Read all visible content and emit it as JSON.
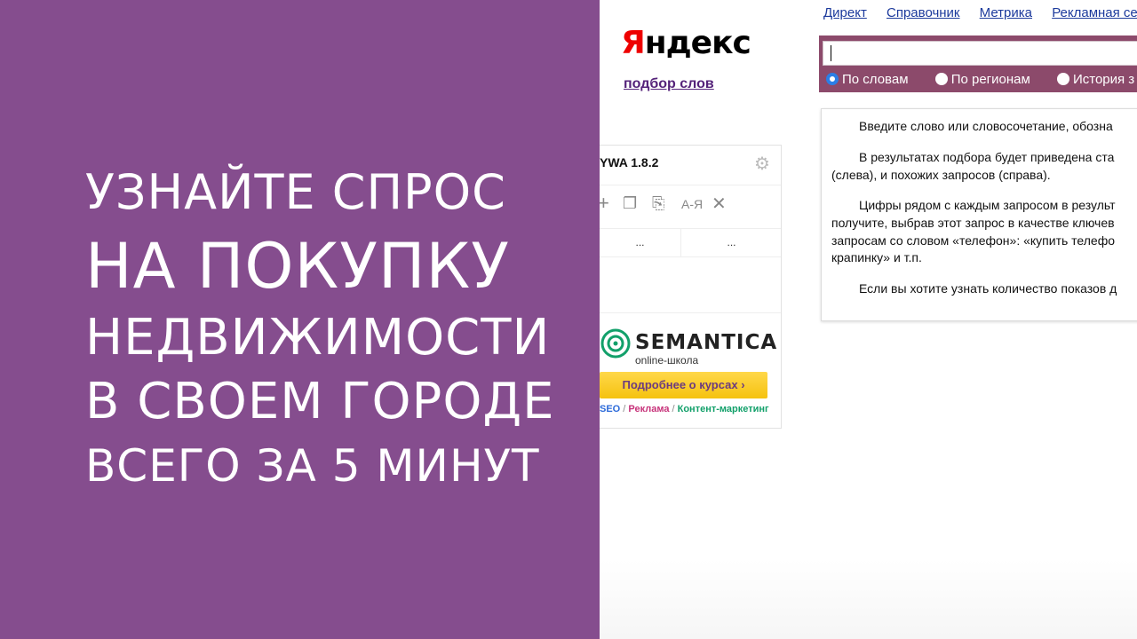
{
  "headline": {
    "line1": "УЗНАЙТЕ СПРОС",
    "line2": "НА ПОКУПКУ",
    "line3": "НЕДВИЖИМОСТИ",
    "line4": "В СВОЕМ ГОРОДЕ",
    "line5": "ВСЕГО ЗА 5 МИНУТ"
  },
  "topnav": [
    "Директ",
    "Справочник",
    "Метрика",
    "Рекламная се"
  ],
  "logo": {
    "first": "Я",
    "rest": "ндекс"
  },
  "subtitle": "подбор слов",
  "search": {
    "value": "",
    "options": [
      {
        "label": "По словам",
        "selected": true
      },
      {
        "label": "По регионам",
        "selected": false
      },
      {
        "label": "История з",
        "selected": false
      }
    ]
  },
  "info": [
    "Введите слово или словосочетание, обозна",
    "В результатах подбора будет приведена ста",
    "(слева), и похожих запросов (справа).",
    "Цифры рядом с каждым запросом в результ",
    "получите, выбрав этот запрос в качестве ключев",
    "запросам со словом «телефон»: «купить телефо",
    "крапинку» и т.п.",
    "Если вы хотите узнать количество показов д"
  ],
  "extension": {
    "title": "YWA 1.8.2",
    "col1": "...",
    "col2": "...",
    "tool_az": "A-Я"
  },
  "ad": {
    "brand": "SEMANTICA",
    "sub": "online-школа",
    "button": "Подробнее о курсах ›",
    "tag1": "SEO",
    "sep1": " / ",
    "tag2": "Реклама",
    "sep2": " / ",
    "tag3": "Контент-маркетинг"
  },
  "colors": {
    "left_panel": "#854d8e",
    "search_bar": "#8c4a6b",
    "link": "#1c3a9c",
    "ad_button": "#f5c20f"
  }
}
